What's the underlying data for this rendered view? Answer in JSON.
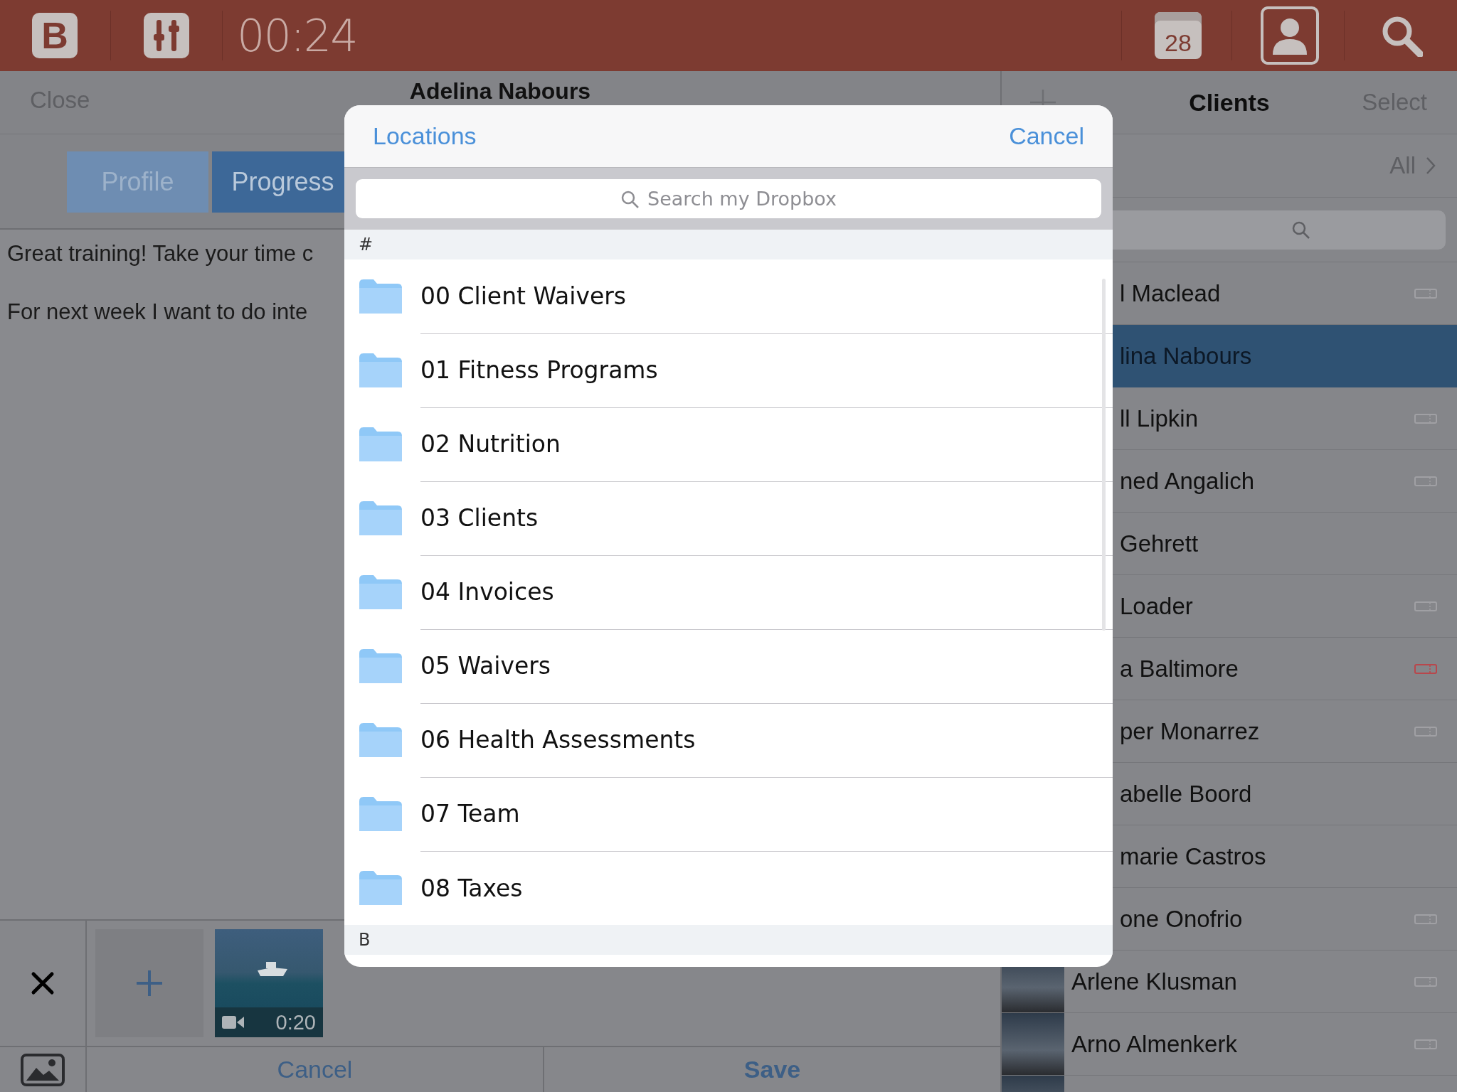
{
  "top_bar": {
    "logo": "B",
    "timer": "00:24",
    "calendar_day": "28"
  },
  "editor": {
    "close": "Close",
    "title": "Adelina Nabours",
    "tabs": [
      {
        "label": "Profile",
        "selected": false
      },
      {
        "label": "Progress",
        "selected": true
      }
    ],
    "notes": [
      "Great training! Take your time c",
      "For next week I want to do inte"
    ],
    "media": [
      {
        "kind": "add"
      },
      {
        "kind": "video",
        "duration": "0:20"
      }
    ],
    "buttons": [
      {
        "label": "Cancel",
        "primary": false
      },
      {
        "label": "Save",
        "primary": true
      }
    ]
  },
  "clients": {
    "title": "Clients",
    "select": "Select",
    "filter": "All",
    "rows": [
      {
        "name": "l Maclead",
        "selected": false,
        "photo": false,
        "color": "#a0a0a4"
      },
      {
        "name": "lina Nabours",
        "selected": true,
        "photo": false
      },
      {
        "name": "ll Lipkin",
        "selected": false,
        "photo": false,
        "color": "#a0a0a4"
      },
      {
        "name": "ned Angalich",
        "selected": false,
        "photo": false,
        "color": "#a0a0a4"
      },
      {
        "name": "Gehrett",
        "selected": false,
        "photo": false
      },
      {
        "name": "Loader",
        "selected": false,
        "photo": false,
        "color": "#a0a0a4"
      },
      {
        "name": "a Baltimore",
        "selected": false,
        "photo": false,
        "color": "#b8474c"
      },
      {
        "name": "per Monarrez",
        "selected": false,
        "photo": false,
        "color": "#a0a0a4"
      },
      {
        "name": "abelle Boord",
        "selected": false,
        "photo": false
      },
      {
        "name": "marie Castros",
        "selected": false,
        "photo": false
      },
      {
        "name": "one Onofrio",
        "selected": false,
        "photo": false,
        "color": "#a0a0a4"
      },
      {
        "name": "Arlene Klusman",
        "selected": false,
        "photo": true,
        "color": "#a0a0a4"
      },
      {
        "name": "Arno Almenkerk",
        "selected": false,
        "photo": true,
        "color": "#a0a0a4"
      },
      {
        "selected": false,
        "photo": true
      }
    ]
  },
  "locations": {
    "title": "Locations",
    "cancel": "Cancel",
    "search_placeholder": "Search my Dropbox",
    "sections": [
      {
        "title": "#",
        "folders": [
          "00 Client Waivers",
          "01 Fitness Programs",
          "02 Nutrition",
          "03 Clients",
          "04 Invoices",
          "05 Waivers",
          "06 Health Assessments",
          "07 Team",
          "08 Taxes"
        ]
      },
      {
        "title": "B"
      }
    ]
  }
}
